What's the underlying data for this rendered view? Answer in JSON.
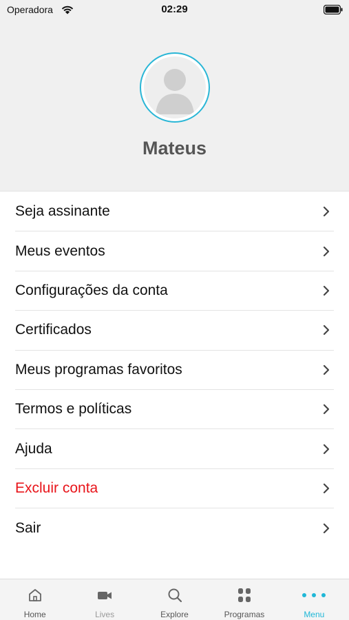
{
  "status_bar": {
    "carrier": "Operadora",
    "time": "02:29"
  },
  "profile": {
    "name": "Mateus",
    "avatar_icon": "user-placeholder-icon",
    "accent_color": "#29b6d6"
  },
  "menu": {
    "items": [
      {
        "label": "Seja assinante",
        "style": "normal"
      },
      {
        "label": "Meus eventos",
        "style": "normal"
      },
      {
        "label": "Configurações da conta",
        "style": "normal"
      },
      {
        "label": "Certificados",
        "style": "normal"
      },
      {
        "label": "Meus programas favoritos",
        "style": "normal"
      },
      {
        "label": "Termos e políticas",
        "style": "normal"
      },
      {
        "label": "Ajuda",
        "style": "normal"
      },
      {
        "label": "Excluir conta",
        "style": "danger"
      },
      {
        "label": "Sair",
        "style": "normal"
      }
    ],
    "danger_color": "#e8141a"
  },
  "tab_bar": {
    "tabs": [
      {
        "label": "Home",
        "icon": "home-icon"
      },
      {
        "label": "Lives",
        "icon": "video-camera-icon"
      },
      {
        "label": "Explore",
        "icon": "search-icon"
      },
      {
        "label": "Programas",
        "icon": "grid-icon"
      },
      {
        "label": "Menu",
        "icon": "more-dots-icon"
      }
    ],
    "active_tab": "Menu",
    "active_color": "#1fb7d7"
  }
}
